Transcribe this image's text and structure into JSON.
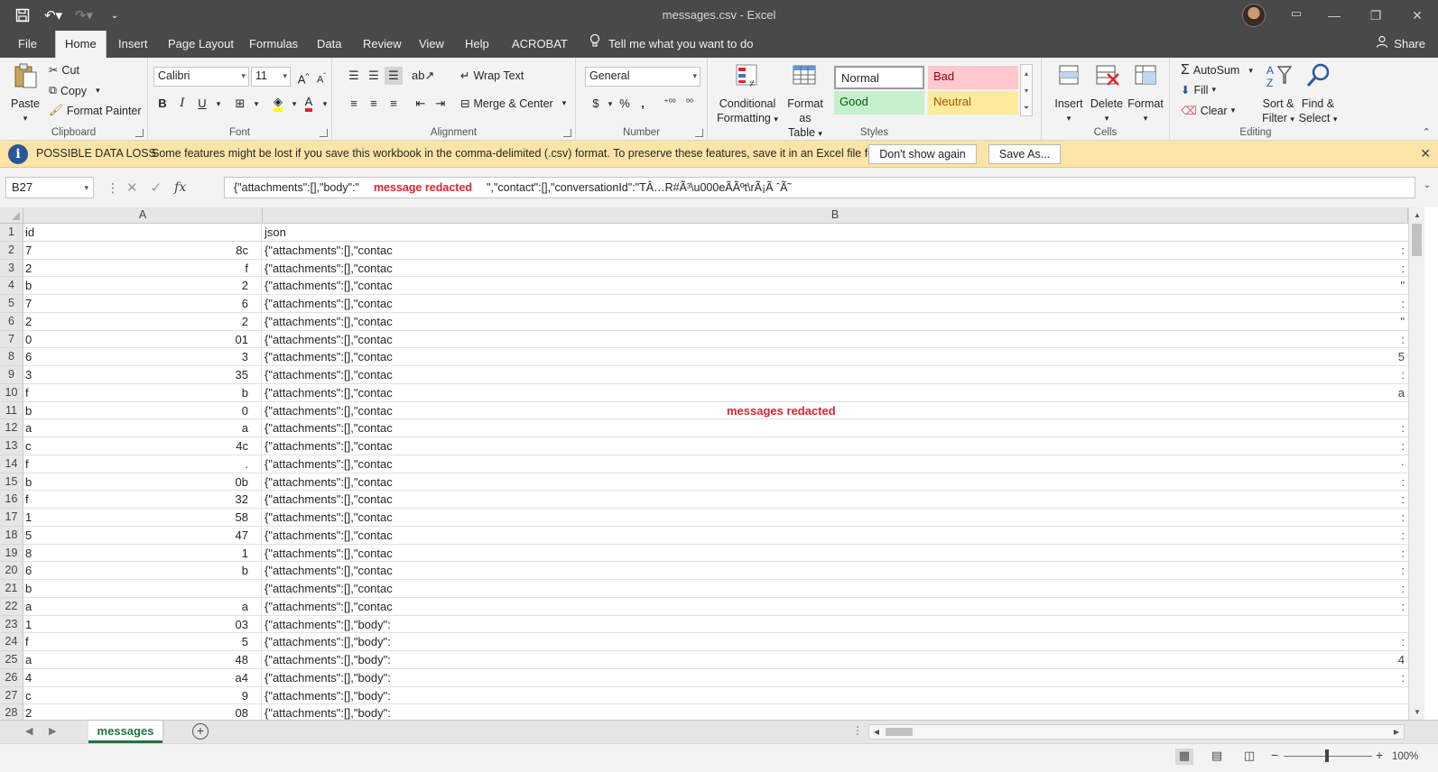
{
  "window": {
    "title": "messages.csv  -  Excel",
    "share_label": "Share"
  },
  "tabs": [
    {
      "label": "File"
    },
    {
      "label": "Home"
    },
    {
      "label": "Insert"
    },
    {
      "label": "Page Layout"
    },
    {
      "label": "Formulas"
    },
    {
      "label": "Data"
    },
    {
      "label": "Review"
    },
    {
      "label": "View"
    },
    {
      "label": "Help"
    },
    {
      "label": "ACROBAT"
    }
  ],
  "tell_me": "Tell me what you want to do",
  "ribbon": {
    "clipboard": {
      "label": "Clipboard",
      "paste": "Paste",
      "cut": "Cut",
      "copy": "Copy",
      "format_painter": "Format Painter"
    },
    "font": {
      "label": "Font",
      "font_name": "Calibri",
      "font_size": "11",
      "bold": "B",
      "italic": "I",
      "underline": "U"
    },
    "alignment": {
      "label": "Alignment",
      "wrap_text": "Wrap Text",
      "merge_center": "Merge & Center"
    },
    "number": {
      "label": "Number",
      "format": "General",
      "currency": "$",
      "percent": "%",
      "comma": ","
    },
    "styles": {
      "label": "Styles",
      "conditional": "Conditional Formatting",
      "conditional_l1": "Conditional",
      "conditional_l2": "Formatting",
      "format_table_l1": "Format as",
      "format_table_l2": "Table",
      "normal": "Normal",
      "bad": "Bad",
      "good": "Good",
      "neutral": "Neutral"
    },
    "cells": {
      "label": "Cells",
      "insert": "Insert",
      "delete": "Delete",
      "format": "Format"
    },
    "editing": {
      "label": "Editing",
      "autosum": "AutoSum",
      "fill": "Fill",
      "clear": "Clear",
      "sort_l1": "Sort &",
      "sort_l2": "Filter",
      "find_l1": "Find &",
      "find_l2": "Select"
    }
  },
  "message_bar": {
    "title": "POSSIBLE DATA LOSS",
    "text": "Some features might be lost if you save this workbook in the comma-delimited (.csv) format. To preserve these features, save it in an Excel file format.",
    "dont_show": "Don't show again",
    "save_as": "Save As..."
  },
  "formula_bar": {
    "name_box": "B27",
    "formula_prefix": "{\"attachments\":[],\"body\":\"",
    "formula_redacted": "message redacted",
    "formula_suffix": "\",\"contact\":[],\"conversationId\":\"TÂ…R#Ã³\\u000eÃÃºt\\rÃ¡Ã ˆÃ˜"
  },
  "grid": {
    "col_a": "A",
    "col_b": "B",
    "redacted_note": "messages redacted",
    "rows": [
      {
        "n": "1",
        "a_first": "id",
        "a_last": "",
        "b": "json",
        "tail": ""
      },
      {
        "n": "2",
        "a_first": "7",
        "a_last": "8c",
        "b": "{\"attachments\":[],\"contac",
        "tail": ":"
      },
      {
        "n": "3",
        "a_first": "2",
        "a_last": "f",
        "b": "{\"attachments\":[],\"contac",
        "tail": ":"
      },
      {
        "n": "4",
        "a_first": "b",
        "a_last": "2",
        "b": "{\"attachments\":[],\"contac",
        "tail": "\""
      },
      {
        "n": "5",
        "a_first": "7",
        "a_last": "6",
        "b": "{\"attachments\":[],\"contac",
        "tail": ":"
      },
      {
        "n": "6",
        "a_first": "2",
        "a_last": "2",
        "b": "{\"attachments\":[],\"contac",
        "tail": "\""
      },
      {
        "n": "7",
        "a_first": "0",
        "a_last": "01",
        "b": "{\"attachments\":[],\"contac",
        "tail": ":"
      },
      {
        "n": "8",
        "a_first": "6",
        "a_last": "3",
        "b": "{\"attachments\":[],\"contac",
        "tail": "5"
      },
      {
        "n": "9",
        "a_first": "3",
        "a_last": "35",
        "b": "{\"attachments\":[],\"contac",
        "tail": ":"
      },
      {
        "n": "10",
        "a_first": "f",
        "a_last": "b",
        "b": "{\"attachments\":[],\"contac",
        "tail": "a"
      },
      {
        "n": "11",
        "a_first": "b",
        "a_last": "0",
        "b": "{\"attachments\":[],\"contac",
        "tail": ""
      },
      {
        "n": "12",
        "a_first": "a",
        "a_last": "a",
        "b": "{\"attachments\":[],\"contac",
        "tail": ":"
      },
      {
        "n": "13",
        "a_first": "c",
        "a_last": "4c",
        "b": "{\"attachments\":[],\"contac",
        "tail": ":"
      },
      {
        "n": "14",
        "a_first": "f",
        "a_last": ".",
        "b": "{\"attachments\":[],\"contac",
        "tail": "·"
      },
      {
        "n": "15",
        "a_first": "b",
        "a_last": "0b",
        "b": "{\"attachments\":[],\"contac",
        "tail": ":"
      },
      {
        "n": "16",
        "a_first": "f",
        "a_last": "32",
        "b": "{\"attachments\":[],\"contac",
        "tail": ":"
      },
      {
        "n": "17",
        "a_first": "1",
        "a_last": "58",
        "b": "{\"attachments\":[],\"contac",
        "tail": ":"
      },
      {
        "n": "18",
        "a_first": "5",
        "a_last": "47",
        "b": "{\"attachments\":[],\"contac",
        "tail": ":"
      },
      {
        "n": "19",
        "a_first": "8",
        "a_last": "1",
        "b": "{\"attachments\":[],\"contac",
        "tail": ":"
      },
      {
        "n": "20",
        "a_first": "6",
        "a_last": "b",
        "b": "{\"attachments\":[],\"contac",
        "tail": ":"
      },
      {
        "n": "21",
        "a_first": "b",
        "a_last": "",
        "b": "{\"attachments\":[],\"contac",
        "tail": ":"
      },
      {
        "n": "22",
        "a_first": "a",
        "a_last": "a",
        "b": "{\"attachments\":[],\"contac",
        "tail": ":"
      },
      {
        "n": "23",
        "a_first": "1",
        "a_last": "03",
        "b": "{\"attachments\":[],\"body\":",
        "tail": ""
      },
      {
        "n": "24",
        "a_first": "f",
        "a_last": "5",
        "b": "{\"attachments\":[],\"body\":",
        "tail": ":"
      },
      {
        "n": "25",
        "a_first": "a",
        "a_last": "48",
        "b": "{\"attachments\":[],\"body\":",
        "tail": "4"
      },
      {
        "n": "26",
        "a_first": "4",
        "a_last": "a4",
        "b": "{\"attachments\":[],\"body\":",
        "tail": ":"
      },
      {
        "n": "27",
        "a_first": "c",
        "a_last": "9",
        "b": "{\"attachments\":[],\"body\":",
        "tail": ""
      },
      {
        "n": "28",
        "a_first": "2",
        "a_last": "08",
        "b": "{\"attachments\":[],\"body\":",
        "tail": ""
      }
    ]
  },
  "sheet": {
    "active_tab": "messages",
    "add_sheet": "+"
  },
  "status": {
    "zoom": "100%"
  },
  "colors": {
    "accent": "#217346",
    "chrome": "#494949",
    "redact": "#e0242b",
    "warn_bg": "#fce4a6"
  }
}
